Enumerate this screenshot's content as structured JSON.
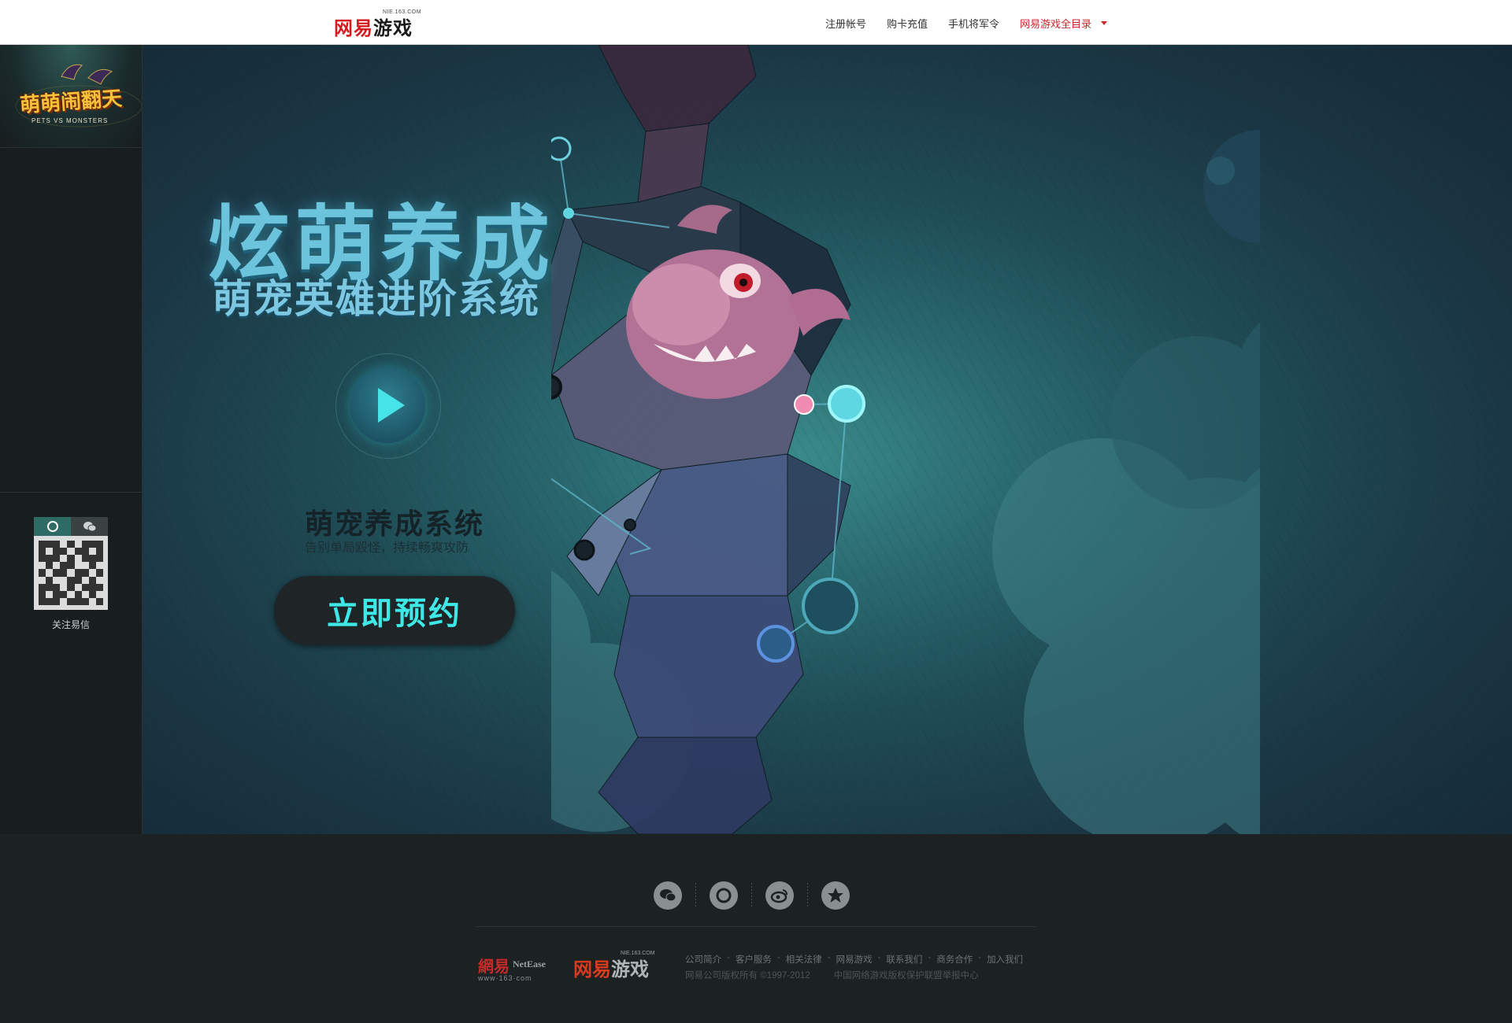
{
  "topbar": {
    "logo_cn": "网易",
    "logo_game": "游戏",
    "logo_domain": "NIE.163.COM",
    "nav": [
      "注册帐号",
      "购卡充值",
      "手机将军令"
    ],
    "catalog": "网易游戏全目录"
  },
  "sidebar": {
    "game_logo_cn": "萌萌闹翻天",
    "game_logo_en": "PETS VS MONSTERS",
    "qr_tabs": [
      "qq-tab",
      "wechat-tab"
    ],
    "qr_caption": "关注易信"
  },
  "hero": {
    "title": "炫萌养成",
    "subtitle": "萌宠英雄进阶系统",
    "feature_title": "萌宠养成系统",
    "feature_desc": "告别单局殴怪，持续畅爽攻防",
    "cta": "立即预约"
  },
  "footer": {
    "social": [
      "wechat-icon",
      "qq-icon",
      "weibo-icon",
      "yixin-icon"
    ],
    "brand_netease_cn": "網易",
    "brand_netease_en": "NetEase",
    "brand_netease_url": "www·163·com",
    "brand_game_cn": "网易",
    "brand_game_game": "游戏",
    "brand_game_domain": "NIE.163.COM",
    "links": [
      "公司简介",
      "客户服务",
      "相关法律",
      "网易游戏",
      "联系我们",
      "商务合作",
      "加入我们"
    ],
    "copyright": "网易公司版权所有 ©1997-2012",
    "union": "中国网络游戏版权保护联盟举报中心"
  },
  "colors": {
    "accent_cyan": "#3ee8e6",
    "brand_red": "#d41b1f",
    "footer_bg": "#1c2122"
  }
}
